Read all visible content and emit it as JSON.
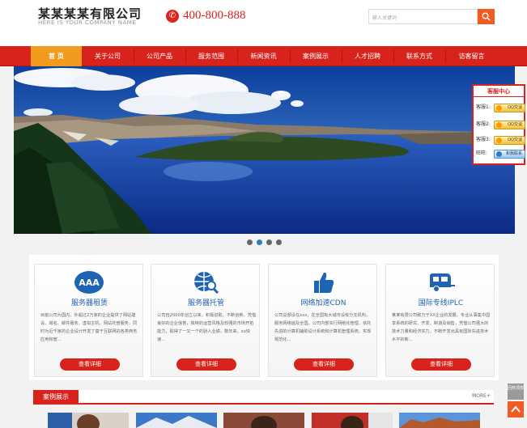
{
  "header": {
    "company_name": "某某某某有限公司",
    "company_slogan": "HERE IS YOUR COMPANY NAME",
    "phone": "400-800-888",
    "search_placeholder": "输入关键词"
  },
  "nav": {
    "items": [
      "首 页",
      "关于公司",
      "公司产品",
      "服务范围",
      "新闻资讯",
      "案例展示",
      "人才招聘",
      "联系方式",
      "访客留言"
    ],
    "active_index": 0
  },
  "banner": {
    "slide_count": 4,
    "active_slide": 1
  },
  "service_panel": {
    "title": "客服中心",
    "rows": [
      {
        "label": "客服1:",
        "button": "QQ交谈"
      },
      {
        "label": "客服2:",
        "button": "QQ交谈"
      },
      {
        "label": "客服3:",
        "button": "QQ交谈"
      },
      {
        "label": "旺旺:",
        "button": "和我联系"
      }
    ]
  },
  "features": [
    {
      "title": "服务器租赁",
      "icon": "aaa-badge-icon",
      "text": "目前公司为国内、外超过2万家的企业提供了网站建设、域名、邮件服务、虚拟主机、网站托管服务，同时为近千家的企业设计开发了基于互联网的各类商务应用和管...",
      "button": "查看详细"
    },
    {
      "title": "服务器托管",
      "icon": "globe-search-icon",
      "text": "公司自2000年创立以来，积极进取，不断创新，凭借良好的企业信誉，独特的运营风格及较强的市场开拓能力，取得了一又一个的骄人业绩，数年来，xx快速...",
      "button": "查看详细"
    },
    {
      "title": "网络加速CDN",
      "icon": "thumbs-up-icon",
      "text": "公司总部设在xxx，在全国有大城市设有分支机构，服务网络遍及全国。公司内部实行网络化管理，依托先进的计算机辅助设计系统和计算机管理系统，实现规范化...",
      "button": "查看详细"
    },
    {
      "title": "国际专线IPLC",
      "icon": "trailer-icon",
      "text": "某某有限公司致力于XX企业的发展，专业从事集中国享系统的研究、开发、制造及销售，凭借公司强大的技术力量和经济实力，不断开发出具有国际先进技术水平的新...",
      "button": "查看详细"
    }
  ],
  "cases": {
    "title": "案例展示",
    "more": "MORE+"
  },
  "float": {
    "top_label": "回到顶部"
  },
  "colors": {
    "brand_red": "#d8231c",
    "nav_active": "#f29a1d",
    "accent_orange": "#f25a22",
    "feature_blue": "#1f63b3"
  }
}
